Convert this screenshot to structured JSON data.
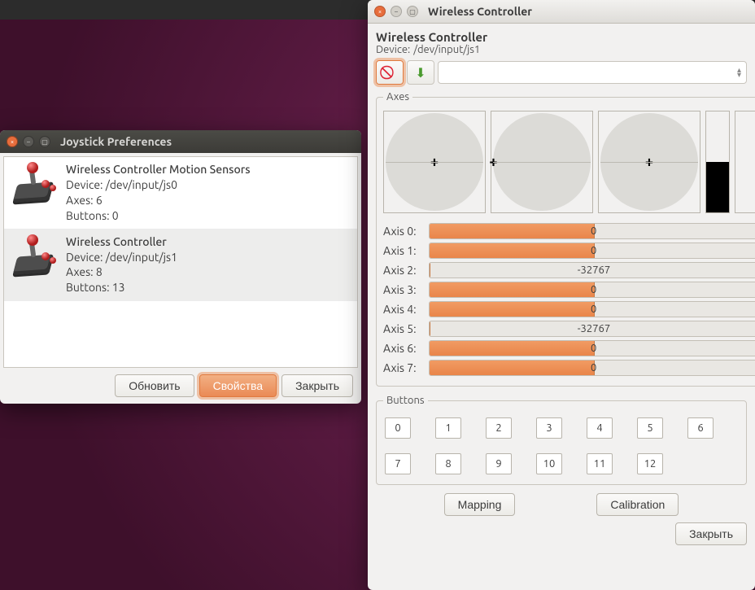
{
  "win1": {
    "title": "Joystick Preferences",
    "devices": [
      {
        "name": "Wireless Controller Motion Sensors",
        "device_label": "Device:",
        "device": "/dev/input/js0",
        "axes_label": "Axes:",
        "axes": "6",
        "buttons_label": "Buttons:",
        "buttons": "0"
      },
      {
        "name": "Wireless Controller",
        "device_label": "Device:",
        "device": "/dev/input/js1",
        "axes_label": "Axes:",
        "axes": "8",
        "buttons_label": "Buttons:",
        "buttons": "13"
      }
    ],
    "refresh_label": "Обновить",
    "props_label": "Свойства",
    "close_label": "Закрыть"
  },
  "win2": {
    "title": "Wireless Controller",
    "heading": "Wireless Controller",
    "device_label": "Device:",
    "device": "/dev/input/js1",
    "axes_group": "Axes",
    "sticks": [
      {
        "x": 50,
        "y": 50
      },
      {
        "x": 2,
        "y": 50
      },
      {
        "x": 50,
        "y": 50
      }
    ],
    "vbars": [
      {
        "fill_pct": 50
      },
      {
        "fill_pct": 0
      }
    ],
    "axes": [
      {
        "label": "Axis 0:",
        "value": "0",
        "fill_pct": 50,
        "mode": "end"
      },
      {
        "label": "Axis 1:",
        "value": "0",
        "fill_pct": 50,
        "mode": "end"
      },
      {
        "label": "Axis 2:",
        "value": "-32767",
        "fill_pct": 0,
        "mode": "center"
      },
      {
        "label": "Axis 3:",
        "value": "0",
        "fill_pct": 50,
        "mode": "end"
      },
      {
        "label": "Axis 4:",
        "value": "0",
        "fill_pct": 50,
        "mode": "end"
      },
      {
        "label": "Axis 5:",
        "value": "-32767",
        "fill_pct": 0,
        "mode": "center"
      },
      {
        "label": "Axis 6:",
        "value": "0",
        "fill_pct": 50,
        "mode": "end"
      },
      {
        "label": "Axis 7:",
        "value": "0",
        "fill_pct": 50,
        "mode": "end"
      }
    ],
    "buttons_group": "Buttons",
    "buttons": [
      "0",
      "1",
      "2",
      "3",
      "4",
      "5",
      "6",
      "7",
      "8",
      "9",
      "10",
      "11",
      "12"
    ],
    "mapping_label": "Mapping",
    "calibration_label": "Calibration",
    "close_label": "Закрыть"
  }
}
